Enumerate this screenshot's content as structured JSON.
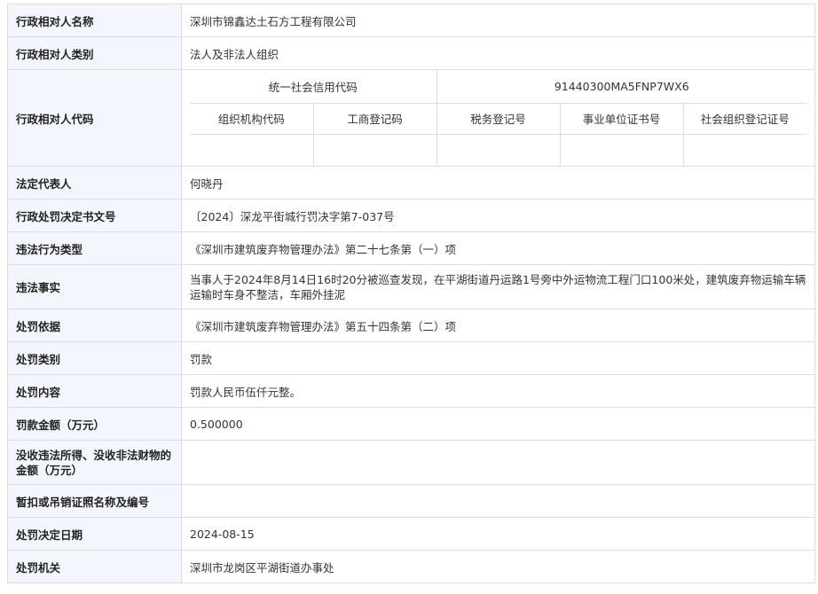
{
  "rows": {
    "party_name": {
      "label": "行政相对人名称",
      "value": "深圳市锦鑫达土石方工程有限公司"
    },
    "party_type": {
      "label": "行政相对人类别",
      "value": "法人及非法人组织"
    },
    "party_code": {
      "label": "行政相对人代码",
      "credit_code_label": "统一社会信用代码",
      "credit_code_value": "91440300MA5FNP7WX6",
      "columns": [
        "组织机构代码",
        "工商登记码",
        "税务登记号",
        "事业单位证书号",
        "社会组织登记证号"
      ],
      "values": [
        "",
        "",
        "",
        "",
        ""
      ]
    },
    "legal_rep": {
      "label": "法定代表人",
      "value": "何晓丹"
    },
    "decision_no": {
      "label": "行政处罚决定书文号",
      "value": "〔2024〕深龙平街城行罚决字第7-037号"
    },
    "violation_type": {
      "label": "违法行为类型",
      "value": "《深圳市建筑废弃物管理办法》第二十七条第（一）项"
    },
    "violation_facts": {
      "label": "违法事实",
      "value": "当事人于2024年8月14日16时20分被巡查发现，在平湖街道丹运路1号旁中外运物流工程门口100米处，建筑废弃物运输车辆运输时车身不整洁，车厢外挂泥"
    },
    "basis": {
      "label": "处罚依据",
      "value": "《深圳市建筑废弃物管理办法》第五十四条第（二）项"
    },
    "category": {
      "label": "处罚类别",
      "value": "罚款"
    },
    "content": {
      "label": "处罚内容",
      "value": "罚款人民币伍仟元整。"
    },
    "fine_amount": {
      "label": "罚款金额（万元）",
      "value": "0.500000"
    },
    "confiscation": {
      "label": "没收违法所得、没收非法财物的金额（万元）",
      "value": ""
    },
    "license": {
      "label": "暂扣或吊销证照名称及编号",
      "value": ""
    },
    "decision_date": {
      "label": "处罚决定日期",
      "value": "2024-08-15"
    },
    "authority": {
      "label": "处罚机关",
      "value": "深圳市龙岗区平湖街道办事处"
    }
  }
}
